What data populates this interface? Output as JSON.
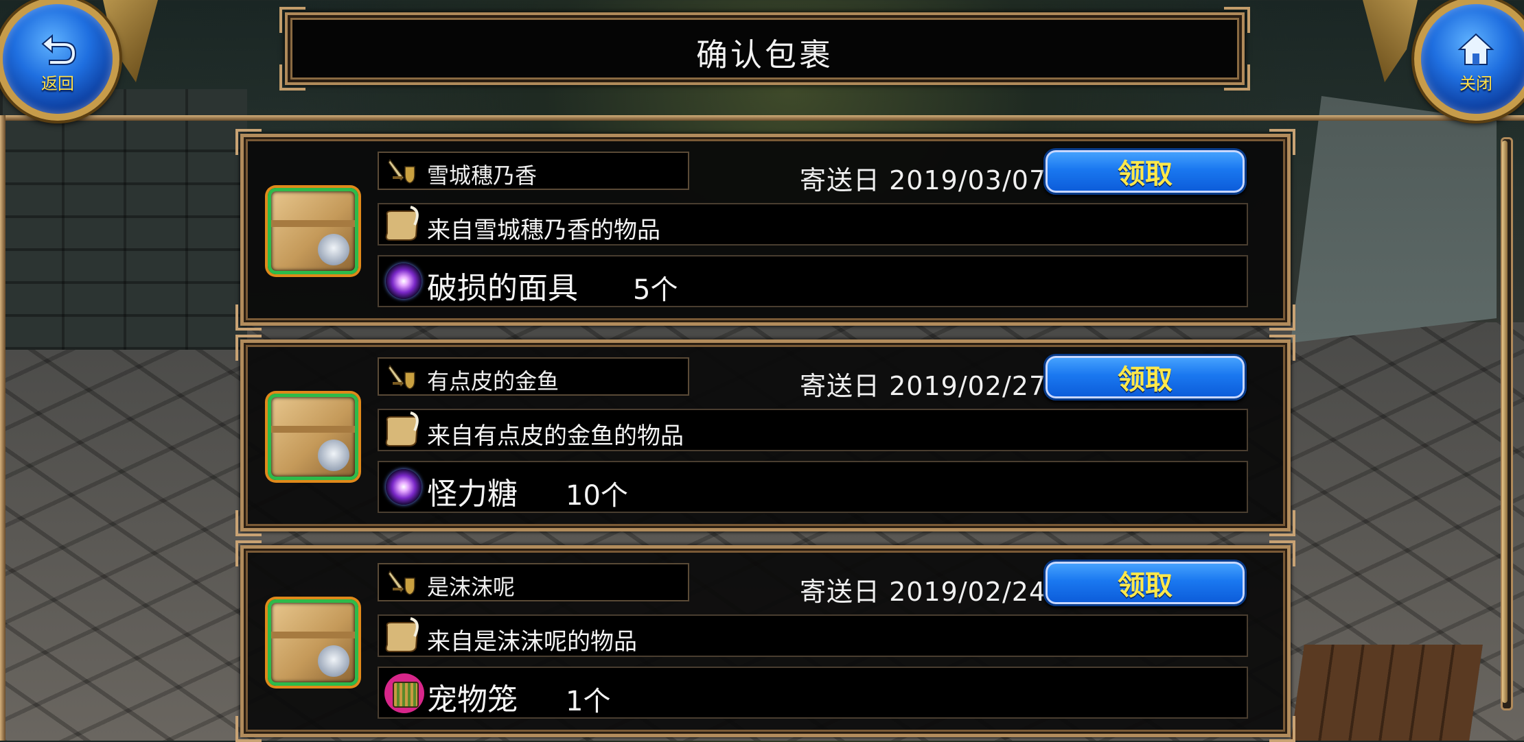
{
  "header": {
    "title": "确认包裹",
    "back_label": "返回",
    "close_label": "关闭"
  },
  "parcels": [
    {
      "sender": "雪城穗乃香",
      "date_prefix": "寄送日",
      "date": "2019/03/07",
      "claim_label": "领取",
      "message": "来自雪城穗乃香的物品",
      "item_name": "破损的面具",
      "item_qty": "5个",
      "item_icon": "purple-orb-icon"
    },
    {
      "sender": "有点皮的金鱼",
      "date_prefix": "寄送日",
      "date": "2019/02/27",
      "claim_label": "领取",
      "message": "来自有点皮的金鱼的物品",
      "item_name": "怪力糖",
      "item_qty": "10个",
      "item_icon": "purple-orb-icon"
    },
    {
      "sender": "是沫沫呢",
      "date_prefix": "寄送日",
      "date": "2019/02/24",
      "claim_label": "领取",
      "message": "来自是沫沫呢的物品",
      "item_name": "宠物笼",
      "item_qty": "1个",
      "item_icon": "pet-cage-icon"
    }
  ],
  "colors": {
    "claim_button": "#1a78f0",
    "claim_text": "#ffe84a",
    "frame_gold": "#b28c5c",
    "package_border": "#2dbb4a"
  }
}
